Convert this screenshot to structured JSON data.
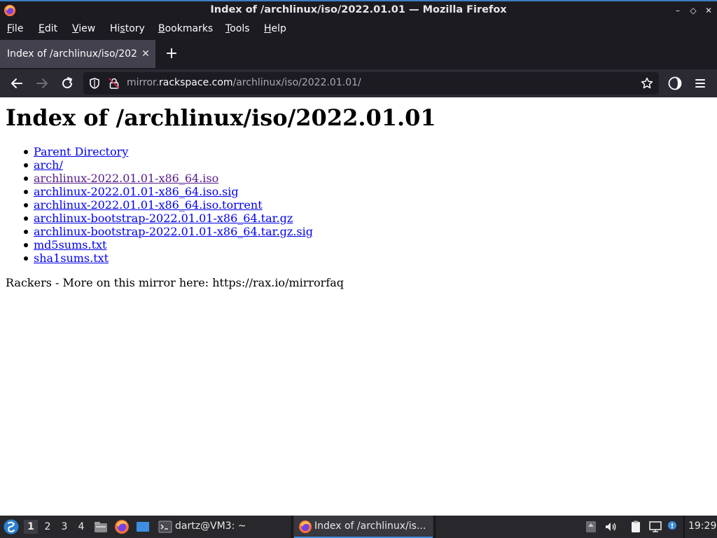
{
  "window": {
    "title": "Index of /archlinux/iso/2022.01.01 — Mozilla Firefox",
    "minimize_glyph": "–",
    "restore_glyph": "◇",
    "close_glyph": "✕"
  },
  "menubar": {
    "items": [
      {
        "first": "F",
        "rest": "ile"
      },
      {
        "first": "E",
        "rest": "dit"
      },
      {
        "first": "V",
        "rest": "iew"
      },
      {
        "pre": "Hi",
        "first": "s",
        "rest": "tory"
      },
      {
        "first": "B",
        "rest": "ookmarks"
      },
      {
        "first": "T",
        "rest": "ools"
      },
      {
        "first": "H",
        "rest": "elp"
      }
    ]
  },
  "tabs": {
    "active_title": "Index of /archlinux/iso/2022",
    "close_glyph": "✕",
    "newtab_glyph": "+"
  },
  "urlbar": {
    "url_prefix": "mirror.",
    "url_domain": "rackspace.com",
    "url_path": "/archlinux/iso/2022.01.01/"
  },
  "page": {
    "heading": "Index of /archlinux/iso/2022.01.01",
    "links": [
      {
        "text": "Parent Directory",
        "visited": false
      },
      {
        "text": "arch/",
        "visited": false
      },
      {
        "text": "archlinux-2022.01.01-x86_64.iso",
        "visited": true
      },
      {
        "text": "archlinux-2022.01.01-x86_64.iso.sig",
        "visited": false
      },
      {
        "text": "archlinux-2022.01.01-x86_64.iso.torrent",
        "visited": false
      },
      {
        "text": "archlinux-bootstrap-2022.01.01-x86_64.tar.gz",
        "visited": false
      },
      {
        "text": "archlinux-bootstrap-2022.01.01-x86_64.tar.gz.sig",
        "visited": false
      },
      {
        "text": "md5sums.txt",
        "visited": false
      },
      {
        "text": "sha1sums.txt",
        "visited": false
      }
    ],
    "footer": "Rackers - More on this mirror here: https://rax.io/mirrorfaq"
  },
  "taskbar": {
    "workspaces": [
      "1",
      "2",
      "3",
      "4"
    ],
    "active_workspace": "1",
    "terminal_task": "dartz@VM3: ~",
    "firefox_task": "Index of /archlinux/is...",
    "clock": "19:29"
  },
  "colors": {
    "link": "#0000ee",
    "visited": "#551a8b",
    "accent": "#3d8ee0"
  }
}
